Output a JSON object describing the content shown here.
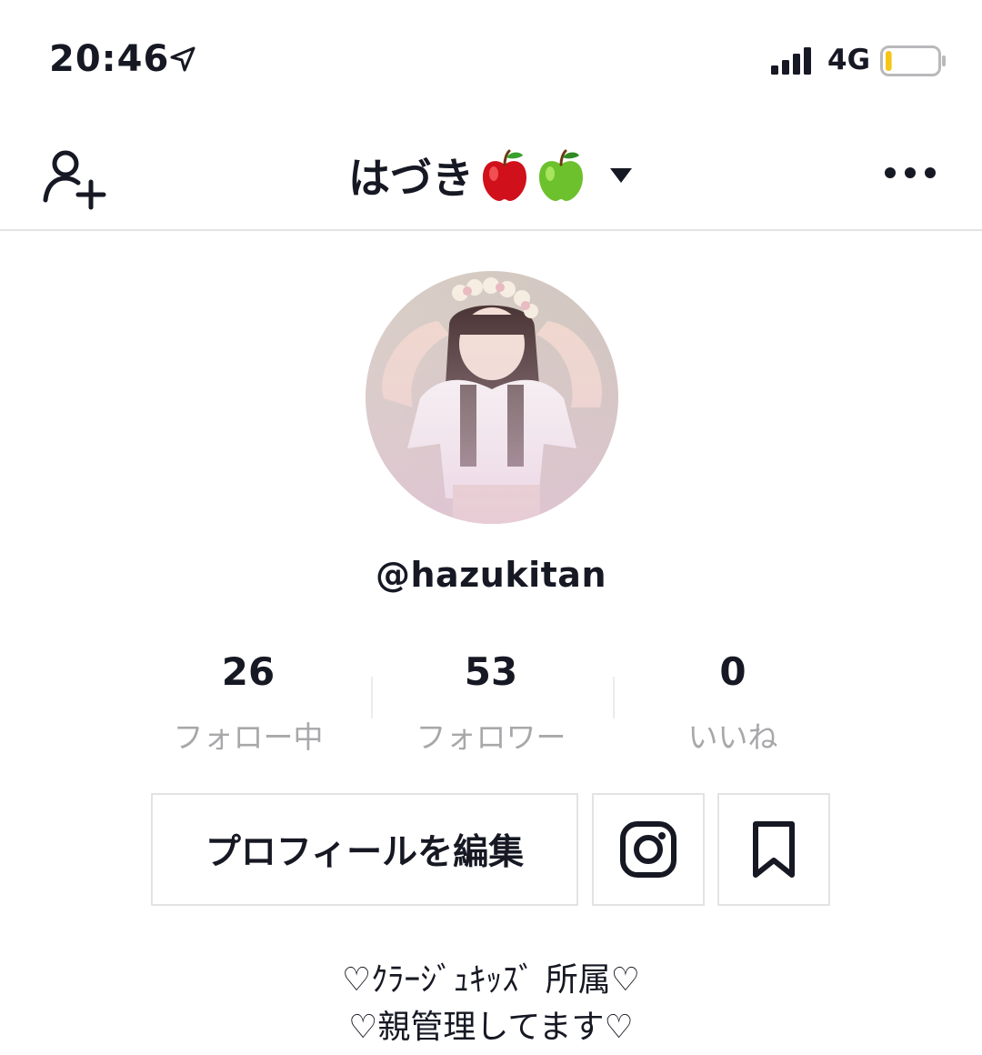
{
  "status_bar": {
    "time": "20:46",
    "location_icon": "location-arrow-icon",
    "signal_icon": "signal-bars-icon",
    "network": "4G",
    "battery_icon": "battery-low-icon",
    "battery_level": 0.12
  },
  "nav": {
    "add_user_icon": "add-user-icon",
    "title": "はづき",
    "title_emojis": [
      "red-apple",
      "green-apple"
    ],
    "dropdown_icon": "caret-down-icon",
    "more_icon": "more-dots-icon"
  },
  "profile": {
    "avatar": "avatar-photo",
    "handle": "@hazukitan"
  },
  "stats": [
    {
      "value": "26",
      "label": "フォロー中"
    },
    {
      "value": "53",
      "label": "フォロワー"
    },
    {
      "value": "0",
      "label": "いいね"
    }
  ],
  "actions": {
    "edit_label": "プロフィールを編集",
    "instagram_icon": "instagram-icon",
    "bookmark_icon": "bookmark-icon"
  },
  "bio": {
    "line1": "♡ｸﾗｰｼﾞｭｷｯｽﾞ 所属♡",
    "line2": "♡親管理してます♡"
  },
  "colors": {
    "text": "#161823",
    "secondary_text": "#a8a8ab",
    "border": "#e3e3e4",
    "battery_fill": "#f5c518"
  }
}
